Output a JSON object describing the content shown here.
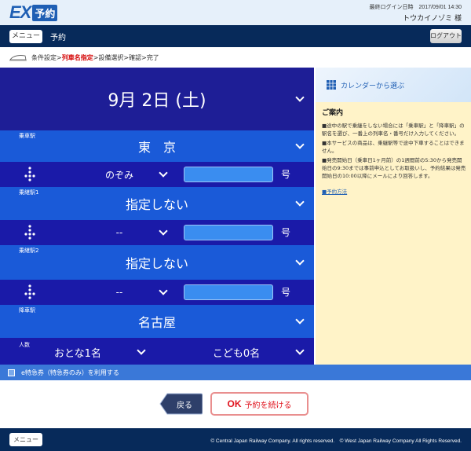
{
  "header": {
    "logo_main": "EX",
    "logo_sub": "予約",
    "login_info": "最終ログイン日時　2017/09/01 14:30",
    "user_name": "トウカイノゾミ 様"
  },
  "nav": {
    "menu_label": "メニュー",
    "title": "予約",
    "logout_label": "ログアウト"
  },
  "steps": {
    "s1": "条件設定",
    "sep1": ">",
    "s2": "列車名指定",
    "sep2": ">",
    "s3": "設備選択",
    "sep3": ">",
    "s4": "確認",
    "sep4": ">",
    "s5": "完了"
  },
  "form": {
    "date": "9月 2日 (土)",
    "dep_label": "乗車駅",
    "dep_value": "東　京",
    "train1_name": "のぞみ",
    "num_suffix1": "号",
    "via1_label": "乗継駅1",
    "via1_value": "指定しない",
    "train2_name": "--",
    "num_suffix2": "号",
    "via2_label": "乗継駅2",
    "via2_value": "指定しない",
    "train3_name": "--",
    "num_suffix3": "号",
    "arr_label": "降車駅",
    "arr_value": "名古屋",
    "people_label": "人数",
    "adults": "おとな1名",
    "children": "こども0名"
  },
  "side": {
    "calendar_label": "カレンダーから選ぶ",
    "guide_title": "ご案内",
    "guide1": "■途中の駅で乗継をしない場合には「乗車駅」と「降車駅」の駅名を選び、一番上の列車名・番号だけ入力してください。",
    "guide2": "■本サービスの商品は、乗継駅等で途中下車することはできません。",
    "guide3": "■発売開始日（乗車日1ヶ月前）の1週間前の5:30から発売開始日の9:30までは事前申込としてお取扱いし、予約結果は発売開始日の10:00以降にメールにより回答します。",
    "guide_link": "■予約方法"
  },
  "ebar": {
    "label": "e特急券（特急券のみ）を利用する"
  },
  "actions": {
    "back_label": "戻る",
    "ok_label": "OK",
    "continue_label": "予約を続ける"
  },
  "footer": {
    "menu_label": "メニュー",
    "copyright": "© Central Japan Railway Company. All rights reserved.　© West Japan Railway Company All Rights Reserved."
  }
}
